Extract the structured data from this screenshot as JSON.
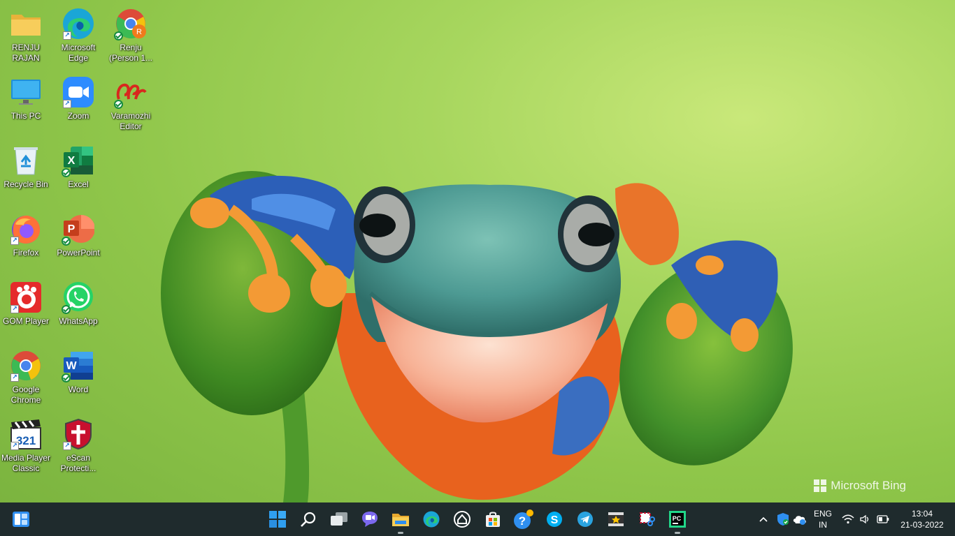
{
  "desktop": {
    "icons": [
      {
        "label": "RENJU RAJAN",
        "icon": "folder-icon"
      },
      {
        "label": "Microsoft Edge",
        "icon": "edge-icon"
      },
      {
        "label": "Renju (Person 1...",
        "icon": "chrome-profile-icon"
      },
      {
        "label": "This PC",
        "icon": "monitor-icon"
      },
      {
        "label": "Zoom",
        "icon": "zoom-icon"
      },
      {
        "label": "Varamozhi Editor",
        "icon": "varamozhi-icon"
      },
      {
        "label": "Recycle Bin",
        "icon": "recycle-bin-icon"
      },
      {
        "label": "Excel",
        "icon": "excel-icon"
      },
      {
        "label": "Firefox",
        "icon": "firefox-icon"
      },
      {
        "label": "PowerPoint",
        "icon": "powerpoint-icon"
      },
      {
        "label": "GOM Player",
        "icon": "gom-player-icon"
      },
      {
        "label": "WhatsApp",
        "icon": "whatsapp-icon"
      },
      {
        "label": "Google Chrome",
        "icon": "chrome-icon"
      },
      {
        "label": "Word",
        "icon": "word-icon"
      },
      {
        "label": "Media Player Classic",
        "icon": "media-player-icon"
      },
      {
        "label": "eScan Protecti...",
        "icon": "escan-icon"
      }
    ]
  },
  "wallpaper": {
    "watermark": "Microsoft Bing"
  },
  "taskbar": {
    "widgets_icon": "widgets-icon",
    "apps": [
      "start-icon",
      "search-icon",
      "task-view-icon",
      "chat-icon",
      "file-explorer-icon",
      "edge-icon",
      "dell-icon",
      "store-icon",
      "help-icon",
      "skype-icon",
      "telegram-icon",
      "video-editor-icon",
      "snipping-icon",
      "pycharm-icon"
    ],
    "tray": {
      "language": "ENG",
      "region": "IN",
      "time": "13:04",
      "date": "21-03-2022"
    }
  },
  "colors": {
    "taskbar_bg": "#1f2b2d",
    "win_blue": "#2f8ff0"
  }
}
